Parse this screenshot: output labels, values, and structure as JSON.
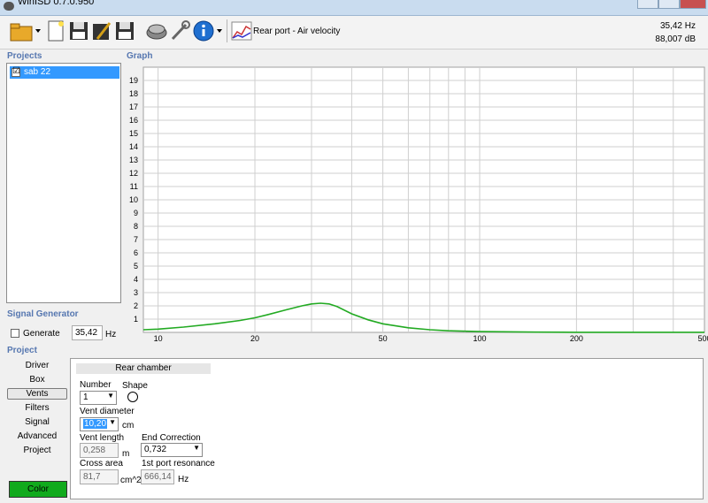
{
  "window": {
    "title": "WinISD 0.7.0.950"
  },
  "toolbar": {
    "icons": [
      "open-folder-icon",
      "new-project-icon",
      "save-icon",
      "edit-icon",
      "save-as-icon",
      "driver-icon",
      "tools-icon",
      "info-icon",
      "chart-icon"
    ],
    "chart_type_label": "Rear port - Air velocity",
    "freq_readout": "35,42 Hz",
    "db_readout": "88,007 dB"
  },
  "sections": {
    "projects": "Projects",
    "graph": "Graph",
    "signal_generator": "Signal Generator",
    "project": "Project"
  },
  "projects": {
    "items": [
      {
        "label": "sab 22",
        "checked": true,
        "check_mark": "☑"
      }
    ]
  },
  "signal_generator": {
    "generate_label": "Generate",
    "frequency": "35,42",
    "unit": "Hz"
  },
  "nav": {
    "items": [
      "Driver",
      "Box",
      "Vents",
      "Filters",
      "Signal",
      "Advanced",
      "Project"
    ],
    "selected": "Vents",
    "color_button": "Color",
    "color_hex": "#11aa1d"
  },
  "vents": {
    "header": "Rear chamber",
    "number_label": "Number",
    "number_value": "1",
    "shape_label": "Shape",
    "vent_diameter_label": "Vent diameter",
    "vent_diameter_value": "10,20",
    "vent_diameter_unit": "cm",
    "vent_length_label": "Vent length",
    "vent_length_value": "0,258",
    "vent_length_unit": "m",
    "end_correction_label": "End Correction",
    "end_correction_value": "0,732",
    "cross_area_label": "Cross area",
    "cross_area_value": "81,7",
    "cross_area_unit": "cm^2",
    "port_resonance_label": "1st port resonance",
    "port_resonance_value": "666,14",
    "port_resonance_unit": "Hz"
  },
  "chart_data": {
    "type": "line",
    "x_scale": "log",
    "xlim": [
      9,
      500
    ],
    "ylim": [
      0,
      20
    ],
    "x_ticks": [
      10,
      20,
      50,
      100,
      200,
      500
    ],
    "y_ticks": [
      1,
      2,
      3,
      4,
      5,
      6,
      7,
      8,
      9,
      10,
      11,
      12,
      13,
      14,
      15,
      16,
      17,
      18,
      19
    ],
    "grid": true,
    "series": [
      {
        "color": "#22aa22",
        "x": [
          9,
          10,
          12,
          15,
          18,
          20,
          22,
          25,
          28,
          30,
          32,
          34,
          36,
          40,
          45,
          50,
          60,
          70,
          80,
          100,
          150,
          200,
          300,
          400,
          500
        ],
        "y": [
          0.2,
          0.25,
          0.4,
          0.65,
          0.9,
          1.1,
          1.35,
          1.7,
          2.0,
          2.15,
          2.2,
          2.15,
          1.95,
          1.4,
          0.95,
          0.65,
          0.35,
          0.2,
          0.12,
          0.06,
          0.02,
          0.01,
          0.01,
          0.01,
          0.01
        ]
      }
    ]
  }
}
